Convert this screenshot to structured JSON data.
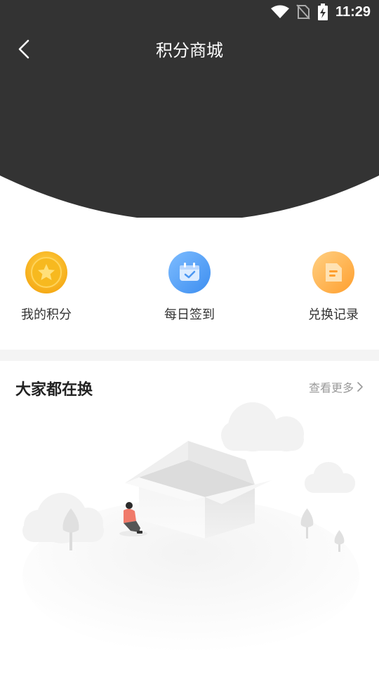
{
  "status_bar": {
    "time": "11:29"
  },
  "header": {
    "title": "积分商城"
  },
  "actions": [
    {
      "label": "我的积分",
      "icon": "star-coin-icon"
    },
    {
      "label": "每日签到",
      "icon": "calendar-check-icon"
    },
    {
      "label": "兑换记录",
      "icon": "document-icon"
    }
  ],
  "section": {
    "title": "大家都在换",
    "more_label": "查看更多"
  },
  "colors": {
    "header_bg": "#333333",
    "coin_yellow": "#f7b91f",
    "checkin_blue": "#5aa3f5",
    "record_orange": "#ffb84d"
  }
}
